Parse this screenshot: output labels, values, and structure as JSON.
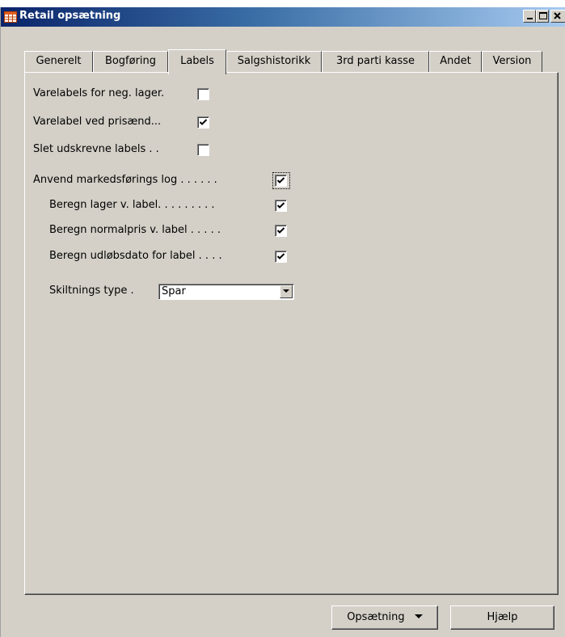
{
  "window": {
    "title": "Retail opsætning"
  },
  "tabs": [
    {
      "label": "Generelt"
    },
    {
      "label": "Bogføring"
    },
    {
      "label": "Labels",
      "active": true
    },
    {
      "label": "Salgshistorikk"
    },
    {
      "label": "3rd parti kasse"
    },
    {
      "label": "Andet"
    },
    {
      "label": "Version"
    }
  ],
  "fields": {
    "neg_lager": {
      "label": "Varelabels for neg. lager.",
      "checked": false
    },
    "prisaend": {
      "label": "Varelabel ved prisænd...",
      "checked": true
    },
    "slet": {
      "label": "Slet udskrevne labels  . .",
      "checked": false
    },
    "markedsforings": {
      "label": "Anvend markedsførings log . . . . . .",
      "checked": true
    },
    "beregn_lager": {
      "label": "Beregn lager v. label. . . . . . . . .",
      "checked": true
    },
    "beregn_normalpris": {
      "label": "Beregn normalpris v. label . . . . .",
      "checked": true
    },
    "beregn_udlob": {
      "label": "Beregn udløbsdato for label  . . . .",
      "checked": true
    },
    "skiltnings": {
      "label": "Skiltnings type  .",
      "value": "Spar"
    }
  },
  "buttons": {
    "opsaetning": "Opsætning",
    "hjaelp": "Hjælp"
  },
  "icons": {
    "window": "table-icon",
    "minimize": "minimize-icon",
    "maximize": "maximize-icon",
    "close": "close-icon"
  }
}
